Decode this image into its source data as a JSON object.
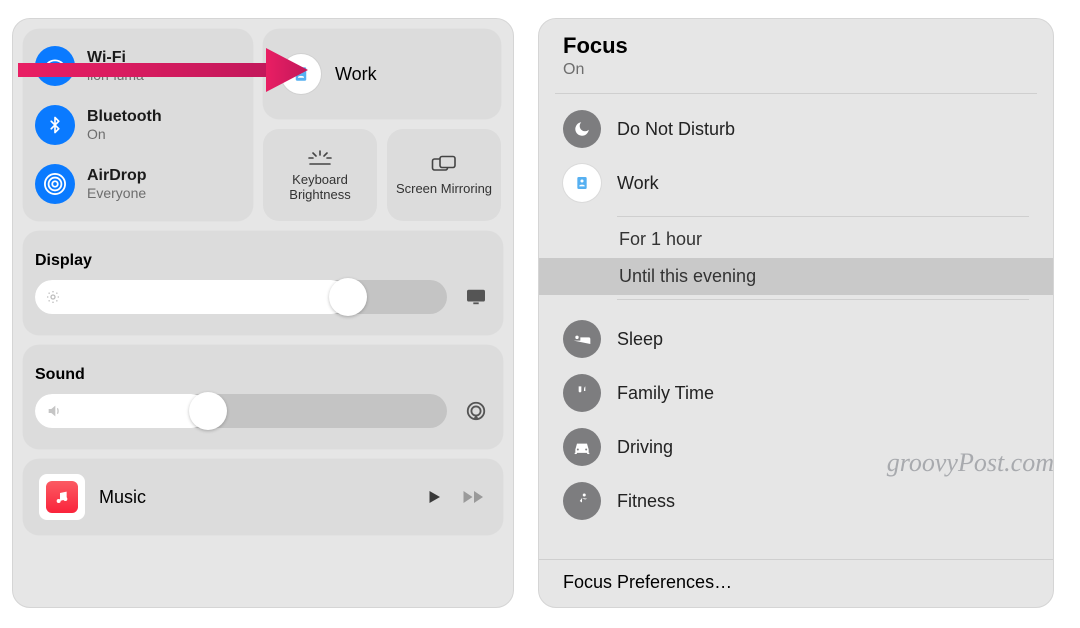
{
  "left": {
    "wifi": {
      "label": "Wi-Fi",
      "status": "lion-luma"
    },
    "bluetooth": {
      "label": "Bluetooth",
      "status": "On"
    },
    "airdrop": {
      "label": "AirDrop",
      "status": "Everyone"
    },
    "focus": {
      "label": "Work"
    },
    "keyboard": {
      "label": "Keyboard Brightness"
    },
    "mirroring": {
      "label": "Screen Mirroring"
    },
    "display": {
      "label": "Display"
    },
    "sound": {
      "label": "Sound"
    },
    "music": {
      "label": "Music"
    }
  },
  "right": {
    "title": "Focus",
    "status": "On",
    "modes": {
      "dnd": "Do Not Disturb",
      "work": "Work",
      "sleep": "Sleep",
      "family": "Family Time",
      "driving": "Driving",
      "fitness": "Fitness"
    },
    "options": {
      "hour": "For 1 hour",
      "evening": "Until this evening"
    },
    "prefs": "Focus Preferences…"
  },
  "watermark": "groovyPost.com"
}
